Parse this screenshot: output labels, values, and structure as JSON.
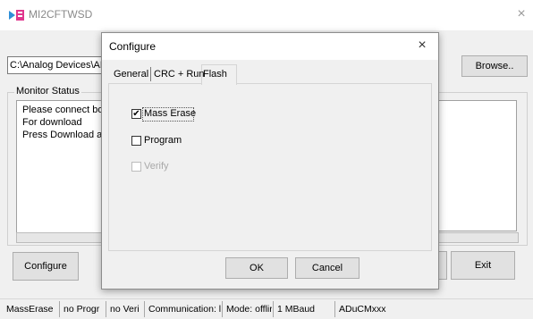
{
  "app": {
    "title": "MI2CFTWSD",
    "path_value": "C:\\Analog Devices\\ADu",
    "browse_label": "Browse..",
    "configure_label": "Configure",
    "exit_label": "Exit",
    "close_glyph": "×"
  },
  "monitor": {
    "legend": "Monitor Status",
    "lines": [
      "Please connect boa",
      "For download",
      "Press Download anc"
    ]
  },
  "statusbar": {
    "cells": [
      "MassErase",
      "no Progr",
      "no Veri",
      "Communication: l",
      "Mode: offlir",
      "1 MBaud",
      "ADuCMxxx"
    ]
  },
  "dialog": {
    "title": "Configure",
    "close_glyph": "×",
    "tabs": [
      "General",
      "CRC + Run",
      "Flash"
    ],
    "active_tab": "Flash",
    "options": [
      {
        "label": "Mass Erase",
        "checked": true,
        "enabled": true
      },
      {
        "label": "Program",
        "checked": false,
        "enabled": true
      },
      {
        "label": "Verify",
        "checked": false,
        "enabled": false
      }
    ],
    "ok_label": "OK",
    "cancel_label": "Cancel"
  },
  "colors": {
    "client_bg": "#f0f0f0",
    "icon_blue": "#2f8fd8",
    "icon_pink": "#e0378e"
  }
}
